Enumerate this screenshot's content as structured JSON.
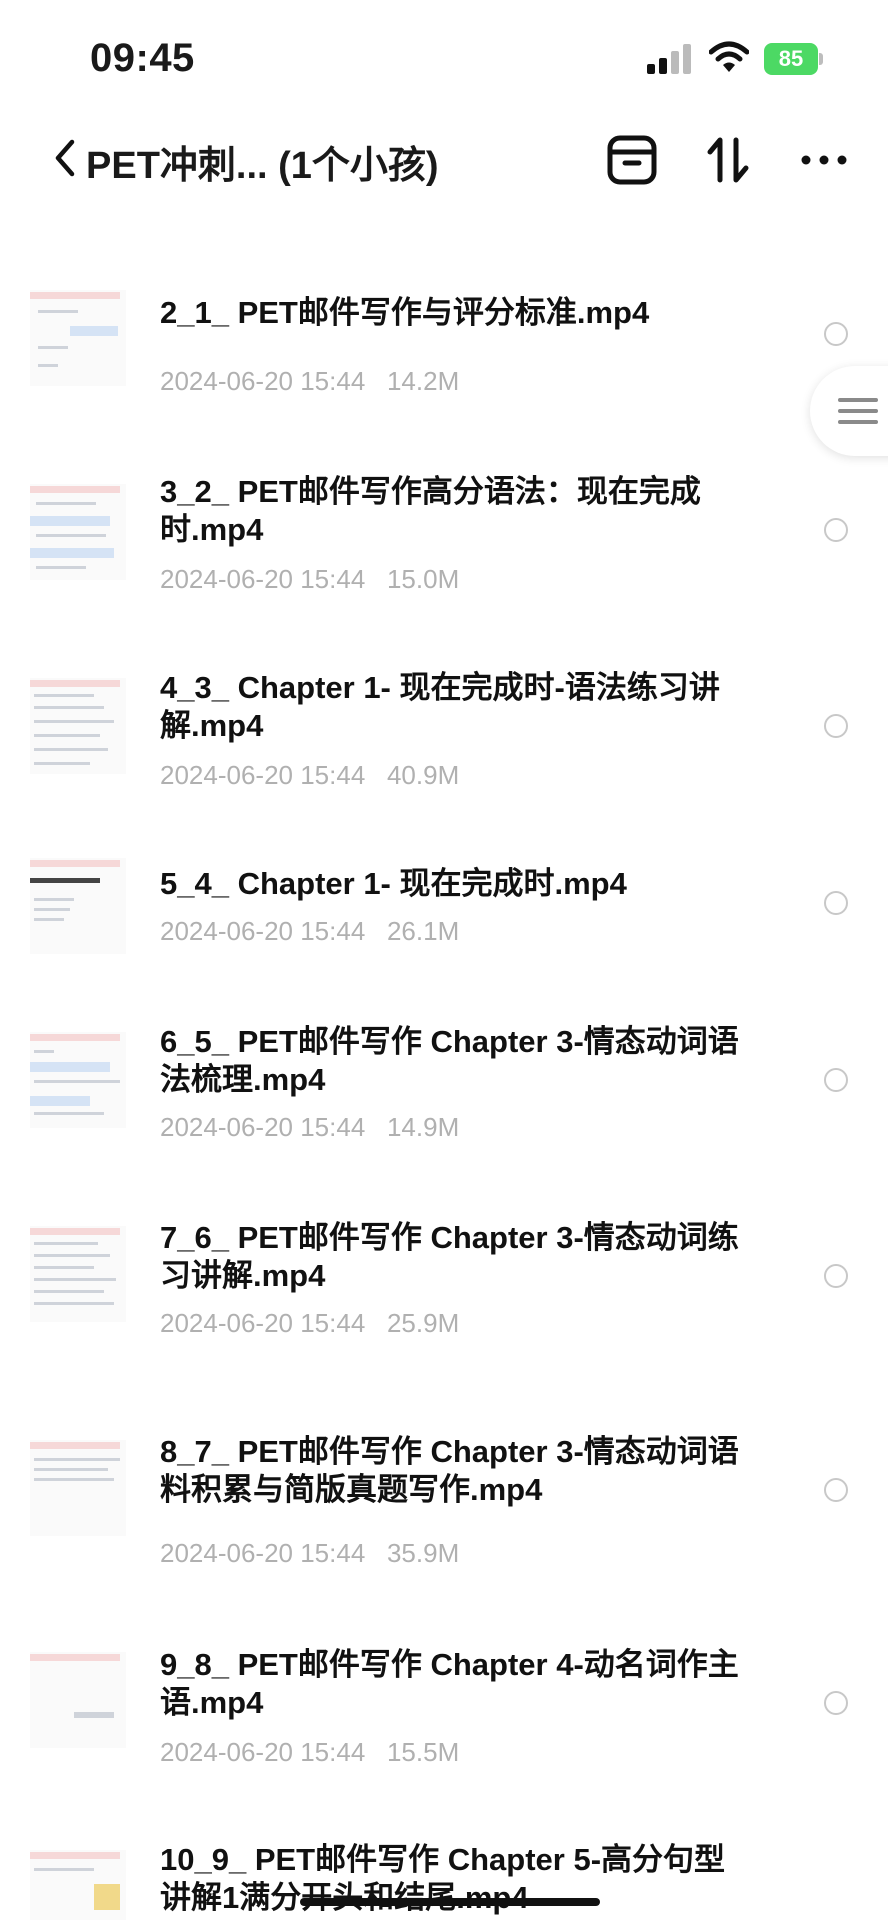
{
  "status_bar": {
    "time": "09:45",
    "battery": "85",
    "battery_color": "#4cd964"
  },
  "nav": {
    "title": "PET冲刺... (1个小孩)",
    "back_icon": "chevron-left-icon",
    "actions": [
      "archive-icon",
      "sort-icon",
      "more-icon"
    ]
  },
  "side_handle_icon": "menu-icon",
  "files": [
    {
      "name": "2_1_ PET邮件写作与评分标准.mp4",
      "date": "2024-06-20 15:44",
      "size": "14.2M"
    },
    {
      "name": "3_2_ PET邮件写作高分语法：现在完成时.mp4",
      "date": "2024-06-20 15:44",
      "size": "15.0M"
    },
    {
      "name": "4_3_ Chapter 1- 现在完成时-语法练习讲解.mp4",
      "date": "2024-06-20 15:44",
      "size": "40.9M"
    },
    {
      "name": "5_4_ Chapter 1- 现在完成时.mp4",
      "date": "2024-06-20 15:44",
      "size": "26.1M"
    },
    {
      "name": "6_5_ PET邮件写作 Chapter 3-情态动词语法梳理.mp4",
      "date": "2024-06-20 15:44",
      "size": "14.9M"
    },
    {
      "name": "7_6_ PET邮件写作 Chapter 3-情态动词练习讲解.mp4",
      "date": "2024-06-20 15:44",
      "size": "25.9M"
    },
    {
      "name": "8_7_ PET邮件写作 Chapter 3-情态动词语料积累与简版真题写作.mp4",
      "date": "2024-06-20 15:44",
      "size": "35.9M"
    },
    {
      "name": "9_8_ PET邮件写作 Chapter 4-动名词作主语.mp4",
      "date": "2024-06-20 15:44",
      "size": "15.5M"
    },
    {
      "name": "10_9_ PET邮件写作 Chapter 5-高分句型讲解1满分开头和结尾.mp4",
      "date": "",
      "size": ""
    }
  ]
}
